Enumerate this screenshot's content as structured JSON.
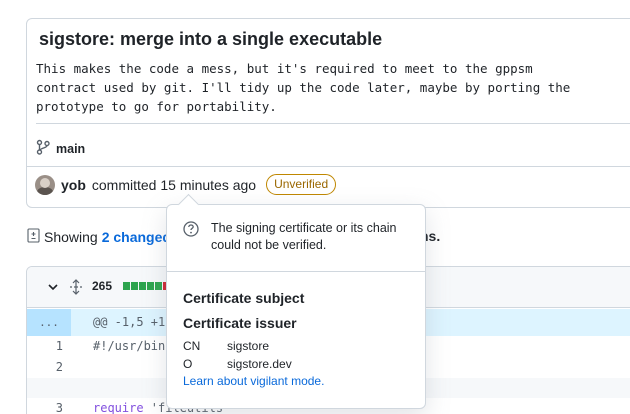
{
  "commit": {
    "title": "sigstore: merge into a single executable",
    "message": "This makes the code a mess, but it's required to meet to the gppsm\ncontract used by git. I'll tidy up the code later, maybe by porting the\nprototype to go for portability.",
    "branch": "main",
    "author": "yob",
    "meta": "committed 15 minutes ago",
    "badge": "Unverified",
    "badge_color": "#9a6700"
  },
  "files_summary": {
    "prefix": "Showing",
    "link": "2 changed",
    "suffix": "ns."
  },
  "diff": {
    "count": "265",
    "blocks": [
      "#2da44e",
      "#2da44e",
      "#2da44e",
      "#2da44e",
      "#2da44e",
      "#cf222e",
      "#afb8c1"
    ],
    "hunk_gutter": "...",
    "hunk_text": "@@ -1,5 +1",
    "lines": [
      {
        "num": "1",
        "text": "#!/usr/bin"
      },
      {
        "num": "2",
        "text": ""
      },
      {
        "num": "3",
        "keyword": "require",
        "text": " 'fileutils'"
      }
    ]
  },
  "popover": {
    "icon": "question-icon",
    "message": "The signing certificate or its chain could not be verified.",
    "subject_heading": "Certificate subject",
    "issuer_heading": "Certificate issuer",
    "issuer_fields": [
      {
        "key": "CN",
        "value": "sigstore"
      },
      {
        "key": "O",
        "value": "sigstore.dev"
      }
    ],
    "link": "Learn about vigilant mode."
  }
}
